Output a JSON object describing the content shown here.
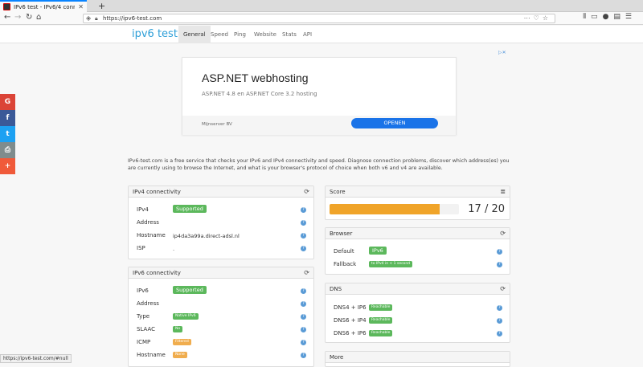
{
  "browser": {
    "tab_title": "IPv6 test - IPv6/4 conne",
    "new_tab": "+",
    "url": "https://ipv6-test.com",
    "status_url": "https://ipv6-test.com/#null"
  },
  "site": {
    "logo": "ipv6 test",
    "nav": [
      "General",
      "Speed",
      "Ping",
      "Website",
      "Stats",
      "API"
    ],
    "active_nav": "General"
  },
  "ad": {
    "headline": "ASP.NET webhosting",
    "subtitle": "ASP.NET 4.8 en ASP.NET Core 3.2 hosting",
    "advertiser": "Mijnserver BV",
    "cta": "OPENEN"
  },
  "social": [
    {
      "icon": "google-icon",
      "glyph": "G",
      "color": "#db4437"
    },
    {
      "icon": "facebook-icon",
      "glyph": "f",
      "color": "#3b5998"
    },
    {
      "icon": "twitter-icon",
      "glyph": "t",
      "color": "#1da1f2"
    },
    {
      "icon": "print-icon",
      "glyph": "⎙",
      "color": "#7f8c8d"
    },
    {
      "icon": "plus-icon",
      "glyph": "+",
      "color": "#f05a3a"
    }
  ],
  "intro": "IPv6-test.com is a free service that checks your IPv6 and IPv4 connectivity and speed. Diagnose connection problems, discover which address(es) you are currently using to browse the Internet, and what is your browser's protocol of choice when both v6 and v4 are available.",
  "ipv4": {
    "title": "IPv4 connectivity",
    "rows": [
      {
        "label": "IPv4",
        "value": "Supported",
        "type": "badge-big",
        "color": "green"
      },
      {
        "label": "Address",
        "value": "",
        "type": "text"
      },
      {
        "label": "Hostname",
        "value": "ip4da3a99a.direct-adsl.nl",
        "type": "text"
      },
      {
        "label": "ISP",
        "value": ".",
        "type": "text"
      }
    ]
  },
  "ipv6": {
    "title": "IPv6 connectivity",
    "rows": [
      {
        "label": "IPv6",
        "value": "Supported",
        "type": "badge-big",
        "color": "green"
      },
      {
        "label": "Address",
        "value": "",
        "type": "text"
      },
      {
        "label": "Type",
        "value": "Native IPv6",
        "type": "badge-small",
        "color": "green"
      },
      {
        "label": "SLAAC",
        "value": "No",
        "type": "badge-small",
        "color": "green"
      },
      {
        "label": "ICMP",
        "value": "Filtered",
        "type": "badge-small",
        "color": "orange"
      },
      {
        "label": "Hostname",
        "value": "None",
        "type": "badge-small",
        "color": "orange"
      }
    ]
  },
  "score": {
    "title": "Score",
    "value": 17,
    "max": 20,
    "display": "17 / 20"
  },
  "browser_panel": {
    "title": "Browser",
    "rows": [
      {
        "label": "Default",
        "value": "IPv6",
        "type": "badge-big",
        "color": "green"
      },
      {
        "label": "Fallback",
        "value": "to IPv4 in < 1 second",
        "type": "badge-small",
        "color": "green"
      }
    ]
  },
  "dns": {
    "title": "DNS",
    "rows": [
      {
        "label": "DNS4 + IP6",
        "value": "Reachable",
        "type": "badge-small",
        "color": "green"
      },
      {
        "label": "DNS6 + IP4",
        "value": "Reachable",
        "type": "badge-small",
        "color": "green"
      },
      {
        "label": "DNS6 + IP6",
        "value": "Reachable",
        "type": "badge-small",
        "color": "green"
      }
    ]
  },
  "more": {
    "title": "More"
  },
  "help_glyph": "?",
  "refresh_glyph": "⟳",
  "list_glyph": "≣"
}
